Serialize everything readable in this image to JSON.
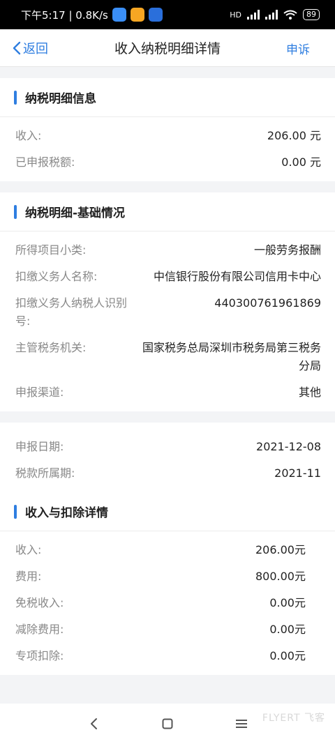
{
  "status_bar": {
    "time_speed": "下午5:17 | 0.8K/s",
    "hd_label": "HD",
    "battery": "89"
  },
  "nav": {
    "back_label": "返回",
    "title": "收入纳税明细详情",
    "appeal_label": "申诉"
  },
  "section1": {
    "title": "纳税明细信息",
    "rows": [
      {
        "label": "收入:",
        "value": "206.00 元"
      },
      {
        "label": "已申报税额:",
        "value": "0.00 元"
      }
    ]
  },
  "section2": {
    "title": "纳税明细-基础情况",
    "rows": [
      {
        "label": "所得项目小类:",
        "value": "一般劳务报酬"
      },
      {
        "label": "扣缴义务人名称:",
        "value": "中信银行股份有限公司信用卡中心"
      },
      {
        "label": "扣缴义务人纳税人识别号:",
        "value": "440300761961869"
      },
      {
        "label": "主管税务机关:",
        "value": "国家税务总局深圳市税务局第三税务分局"
      },
      {
        "label": "申报渠道:",
        "value": "其他"
      }
    ]
  },
  "section3": {
    "rows": [
      {
        "label": "申报日期:",
        "value": "2021-12-08"
      },
      {
        "label": "税款所属期:",
        "value": "2021-11"
      }
    ]
  },
  "section4": {
    "title": "收入与扣除详情",
    "rows": [
      {
        "label": "收入:",
        "value": "206.00元"
      },
      {
        "label": "费用:",
        "value": "800.00元"
      },
      {
        "label": "免税收入:",
        "value": "0.00元"
      },
      {
        "label": "减除费用:",
        "value": "0.00元"
      },
      {
        "label": "专项扣除:",
        "value": "0.00元"
      }
    ]
  },
  "watermark": "FLYERT 飞客",
  "colors": {
    "accent": "#2f7ee0"
  },
  "icons": {
    "back": "chevron-left-icon",
    "nav_back": "triangle-back-icon",
    "nav_home": "square-home-icon",
    "nav_menu": "hamburger-menu-icon"
  }
}
